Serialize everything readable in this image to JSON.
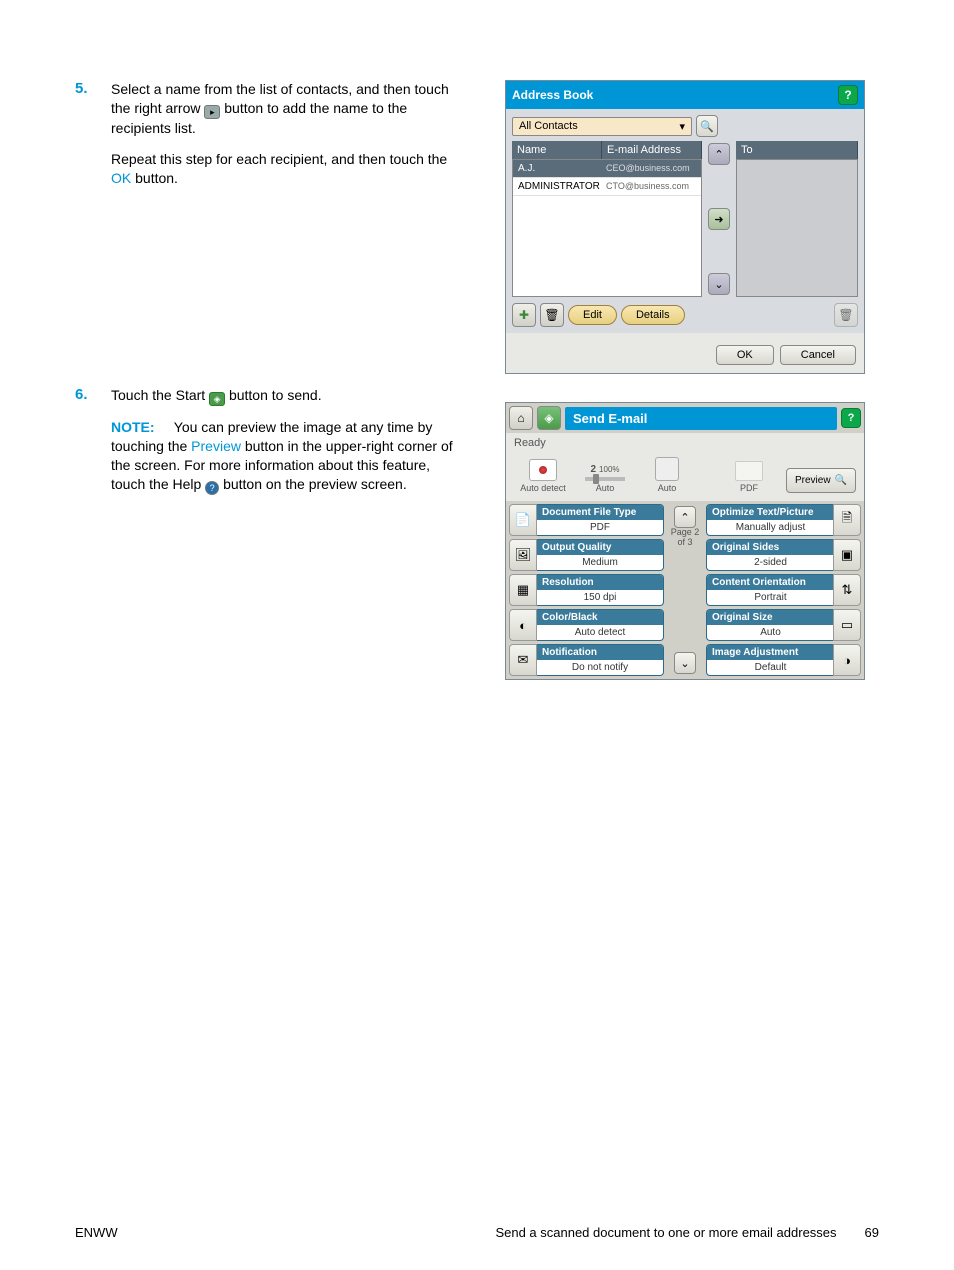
{
  "step5": {
    "num": "5.",
    "para1a": "Select a name from the list of contacts, and then touch the right arrow ",
    "para1b": " button to add the name to the recipients list.",
    "para2a": "Repeat this step for each recipient, and then touch the ",
    "ok": "OK",
    "para2b": " button."
  },
  "step6": {
    "num": "6.",
    "para1a": "Touch the Start ",
    "para1b": " button to send.",
    "note_label": "NOTE:",
    "note_a": "You can preview the image at any time by touching the ",
    "preview": "Preview",
    "note_b": " button in the upper-right corner of the screen. For more information about this feature, touch the Help ",
    "note_c": " button on the preview screen."
  },
  "address_book": {
    "title": "Address Book",
    "dropdown": "All Contacts",
    "col_name": "Name",
    "col_email": "E-mail Address",
    "col_to": "To",
    "rows": [
      {
        "name": "A.J.",
        "email": "CEO@business.com"
      },
      {
        "name": "ADMINISTRATOR",
        "email": "CTO@business.com"
      }
    ],
    "edit": "Edit",
    "details": "Details",
    "ok": "OK",
    "cancel": "Cancel"
  },
  "send_email": {
    "title": "Send E-mail",
    "status": "Ready",
    "zoom_pct": "100%",
    "copies": "2",
    "auto_detect": "Auto detect",
    "auto": "Auto",
    "pdf": "PDF",
    "preview_btn": "Preview",
    "page_ind_1": "Page 2",
    "page_ind_2": "of 3",
    "left": [
      {
        "title": "Document File Type",
        "value": "PDF"
      },
      {
        "title": "Output Quality",
        "value": "Medium"
      },
      {
        "title": "Resolution",
        "value": "150 dpi"
      },
      {
        "title": "Color/Black",
        "value": "Auto detect"
      },
      {
        "title": "Notification",
        "value": "Do not notify"
      }
    ],
    "right": [
      {
        "title": "Optimize Text/Picture",
        "value": "Manually adjust"
      },
      {
        "title": "Original Sides",
        "value": "2-sided"
      },
      {
        "title": "Content Orientation",
        "value": "Portrait"
      },
      {
        "title": "Original Size",
        "value": "Auto"
      },
      {
        "title": "Image Adjustment",
        "value": "Default"
      }
    ]
  },
  "footer": {
    "left": "ENWW",
    "title": "Send a scanned document to one or more email addresses",
    "page": "69"
  }
}
